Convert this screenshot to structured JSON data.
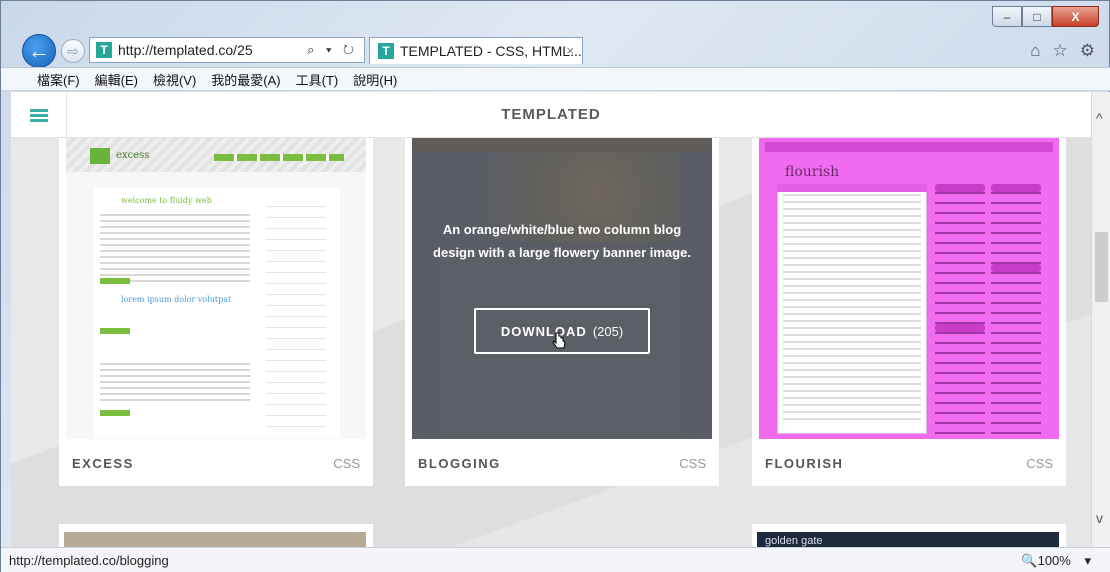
{
  "window": {
    "minimize": "–",
    "maximize": "□",
    "close": "X"
  },
  "address": {
    "url": "http://templated.co/25",
    "favicon": "T",
    "tools": "⌕ ▾ ↻"
  },
  "tab": {
    "title": "TEMPLATED - CSS, HTML...",
    "close": "×",
    "favicon": "T"
  },
  "right_tools": {
    "home": "⌂",
    "star": "☆",
    "gear": "⚙"
  },
  "menu": [
    "檔案(F)",
    "編輯(E)",
    "檢視(V)",
    "我的最愛(A)",
    "工具(T)",
    "說明(H)"
  ],
  "site": {
    "brand": "TEMPLATED"
  },
  "cards": [
    {
      "title": "EXCESS",
      "type": "CSS",
      "logo_text": "excess",
      "heading": "welcome to fluidy web",
      "heading2": "lorem ipsum dolor volutpat"
    },
    {
      "title": "BLOGGING",
      "type": "CSS",
      "description": "An orange/white/blue two column blog design with a large flowery banner image.",
      "download_label": "DOWNLOAD",
      "download_count": "(205)"
    },
    {
      "title": "FLOURISH",
      "type": "CSS",
      "logo_text": "flourish"
    }
  ],
  "bottom_cards": [
    {
      "label": ""
    },
    {
      "label": "golden gate"
    }
  ],
  "status": {
    "url": "http://templated.co/blogging",
    "zoom": "🔍100%",
    "zoom_arrow": "▾"
  },
  "scroll": {
    "up": "^",
    "down": "v"
  },
  "colors": {
    "accent": "#3cb0a4",
    "flourish": "#f06bf0",
    "excess": "#6ab23c"
  }
}
